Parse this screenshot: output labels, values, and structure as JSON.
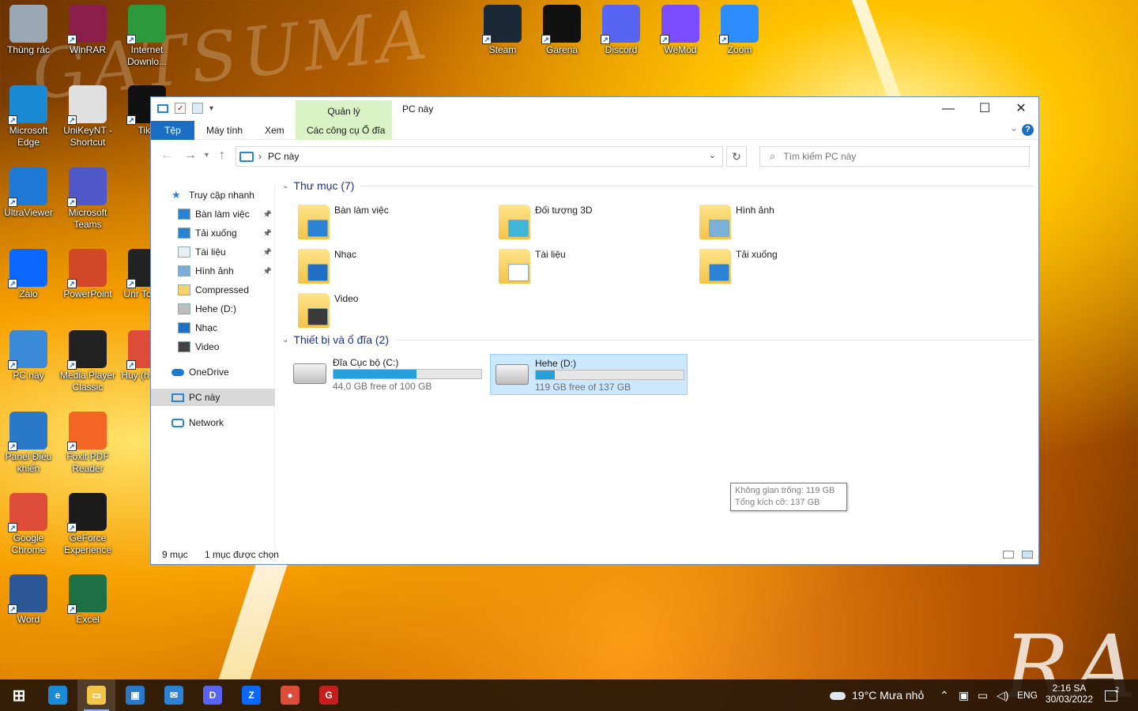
{
  "desktop": {
    "icons": [
      {
        "label": "Thùng rác",
        "color": "#9aa7b5"
      },
      {
        "label": "WinRAR",
        "color": "#8a1f4a"
      },
      {
        "label": "Internet Downlo...",
        "color": "#2c9a3c"
      },
      {
        "label": "Microsoft Edge",
        "color": "#1a8ad4"
      },
      {
        "label": "UniKeyNT - Shortcut",
        "color": "#e0e0e0"
      },
      {
        "label": "TikT",
        "color": "#111111"
      },
      {
        "label": "UltraViewer",
        "color": "#1f7ad6"
      },
      {
        "label": "Microsoft Teams",
        "color": "#5059c9"
      },
      {
        "label": "Zalo",
        "color": "#0a68ff"
      },
      {
        "label": "PowerPoint",
        "color": "#d24726"
      },
      {
        "label": "Unr Tourna",
        "color": "#222222"
      },
      {
        "label": "PC này",
        "color": "#3a8ad8"
      },
      {
        "label": "Media Player Classic",
        "color": "#222222"
      },
      {
        "label": "Huy (h Ghro",
        "color": "#dd4b39"
      },
      {
        "label": "Panel Điều khiển",
        "color": "#2a78c8"
      },
      {
        "label": "Foxit PDF Reader",
        "color": "#f26522"
      },
      {
        "label": "Google Chrome",
        "color": "#dd4b39"
      },
      {
        "label": "GeForce Experience",
        "color": "#1b1b1b"
      },
      {
        "label": "Word",
        "color": "#2b5797"
      },
      {
        "label": "Excel",
        "color": "#1d7044"
      },
      {
        "label": "Steam",
        "color": "#1b2838"
      },
      {
        "label": "Garena",
        "color": "#111111"
      },
      {
        "label": "Discord",
        "color": "#5865f2"
      },
      {
        "label": "WeMod",
        "color": "#7b4cff"
      },
      {
        "label": "Zoom",
        "color": "#2d8cff"
      }
    ],
    "wallpaper_text_1": "GATSUMA",
    "wallpaper_text_2": "RA"
  },
  "explorer": {
    "qat_icons": [
      "pc-icon",
      "properties-icon",
      "new-folder-icon",
      "dropdown-icon"
    ],
    "manage_tab": "Quản lý",
    "title": "PC này",
    "controls": {
      "minimize": "—",
      "maximize": "☐",
      "close": "✕"
    },
    "ribbon_tabs": {
      "file": "Tệp",
      "computer": "Máy tính",
      "view": "Xem",
      "drive_tools": "Các công cụ Ổ đĩa"
    },
    "help": "?",
    "address": {
      "path": "PC này",
      "separator": "›"
    },
    "search": {
      "placeholder": "Tìm kiếm PC này"
    },
    "nav": {
      "quick_access": "Truy cập nhanh",
      "items": [
        {
          "label": "Bàn làm việc",
          "pinned": true,
          "icon": "desktop-icon"
        },
        {
          "label": "Tải xuống",
          "pinned": true,
          "icon": "download-icon"
        },
        {
          "label": "Tài liệu",
          "pinned": true,
          "icon": "document-icon"
        },
        {
          "label": "Hình ảnh",
          "pinned": true,
          "icon": "pictures-icon"
        },
        {
          "label": "Compressed",
          "pinned": false,
          "icon": "folder-icon"
        },
        {
          "label": "Hehe (D:)",
          "pinned": false,
          "icon": "drive-icon"
        },
        {
          "label": "Nhạc",
          "pinned": false,
          "icon": "music-icon"
        },
        {
          "label": "Video",
          "pinned": false,
          "icon": "video-icon"
        }
      ],
      "onedrive": "OneDrive",
      "this_pc": "PC này",
      "network": "Network"
    },
    "folders_header": "Thư mục (7)",
    "folders": [
      {
        "label": "Bàn làm việc",
        "accent": "#2a83d4"
      },
      {
        "label": "Đối tượng 3D",
        "accent": "#3fb6d8"
      },
      {
        "label": "Hình ảnh",
        "accent": "#7ab0d8"
      },
      {
        "label": "Nhạc",
        "accent": "#1f6fc4"
      },
      {
        "label": "Tài liệu",
        "accent": "#ffffff"
      },
      {
        "label": "Tải xuống",
        "accent": "#2a83d4"
      },
      {
        "label": "Video",
        "accent": "#3a3a3a"
      }
    ],
    "drives_header": "Thiết bị và ổ đĩa (2)",
    "drives": [
      {
        "name": "Đĩa Cục bộ (C:)",
        "free": "44,0 GB free of 100 GB",
        "used_fraction": 0.56,
        "selected": false
      },
      {
        "name": "Hehe (D:)",
        "free": "119 GB free of 137 GB",
        "used_fraction": 0.13,
        "selected": true
      }
    ],
    "tooltip": {
      "line1": "Không gian trống: 119 GB",
      "line2": "Tổng kích cỡ: 137 GB"
    },
    "status": {
      "count": "9 mục",
      "selected": "1 mục được chọn"
    }
  },
  "taskbar": {
    "apps": [
      {
        "name": "start-button",
        "glyph": "⊞",
        "color": "#ffffff"
      },
      {
        "name": "edge",
        "glyph": "e",
        "color": "#1a8ad4"
      },
      {
        "name": "file-explorer",
        "glyph": "▭",
        "color": "#f2c44a",
        "active": true
      },
      {
        "name": "store",
        "glyph": "▣",
        "color": "#2a78c8"
      },
      {
        "name": "mail",
        "glyph": "✉",
        "color": "#2a83d4"
      },
      {
        "name": "discord",
        "glyph": "D",
        "color": "#5865f2"
      },
      {
        "name": "zalo",
        "glyph": "Z",
        "color": "#0a68ff"
      },
      {
        "name": "chrome-profile",
        "glyph": "●",
        "color": "#dd4b39"
      },
      {
        "name": "garena",
        "glyph": "G",
        "color": "#c41e1e"
      }
    ],
    "weather": "19°C  Mưa nhỏ",
    "language": "ENG",
    "time": "2:16 SA",
    "date": "30/03/2022",
    "notification_count": "2"
  }
}
